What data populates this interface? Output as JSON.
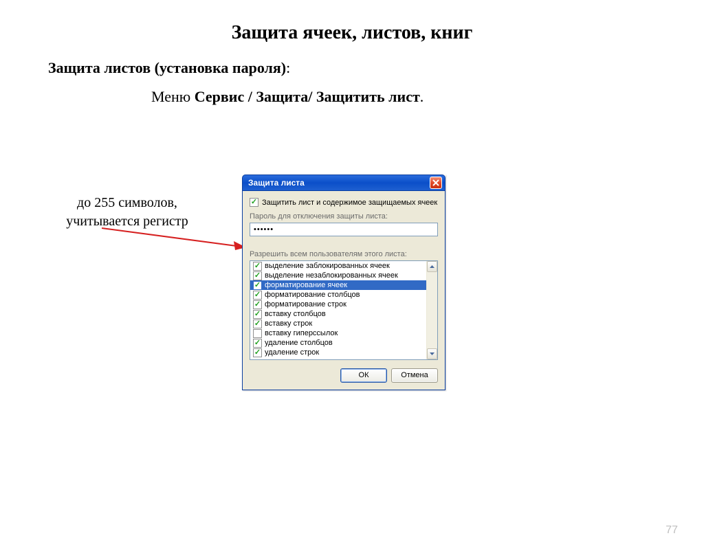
{
  "title": "Защита ячеек, листов, книг",
  "subtitle_bold": "Защита листов (установка пароля)",
  "subtitle_tail": ":",
  "menupath_prefix": "Меню ",
  "menupath_bold": "Сервис / Защита/ Защитить лист",
  "menupath_tail": ".",
  "annotation_line1": "до 255 символов,",
  "annotation_line2": "учитывается регистр",
  "page_number": "77",
  "dialog": {
    "title": "Защита листа",
    "protect_checkbox_label": "Защитить лист и содержимое защищаемых ячеек",
    "protect_checked": true,
    "password_label": "Пароль для отключения защиты листа:",
    "password_value": "••••••",
    "allow_label": "Разрешить всем пользователям этого листа:",
    "options": [
      {
        "label": "выделение заблокированных ячеек",
        "checked": true,
        "selected": false
      },
      {
        "label": "выделение незаблокированных ячеек",
        "checked": true,
        "selected": false
      },
      {
        "label": "форматирование ячеек",
        "checked": true,
        "selected": true
      },
      {
        "label": "форматирование столбцов",
        "checked": true,
        "selected": false
      },
      {
        "label": "форматирование строк",
        "checked": true,
        "selected": false
      },
      {
        "label": "вставку столбцов",
        "checked": true,
        "selected": false
      },
      {
        "label": "вставку строк",
        "checked": true,
        "selected": false
      },
      {
        "label": "вставку гиперссылок",
        "checked": false,
        "selected": false
      },
      {
        "label": "удаление столбцов",
        "checked": true,
        "selected": false
      },
      {
        "label": "удаление строк",
        "checked": true,
        "selected": false
      }
    ],
    "ok_label": "ОК",
    "cancel_label": "Отмена"
  }
}
